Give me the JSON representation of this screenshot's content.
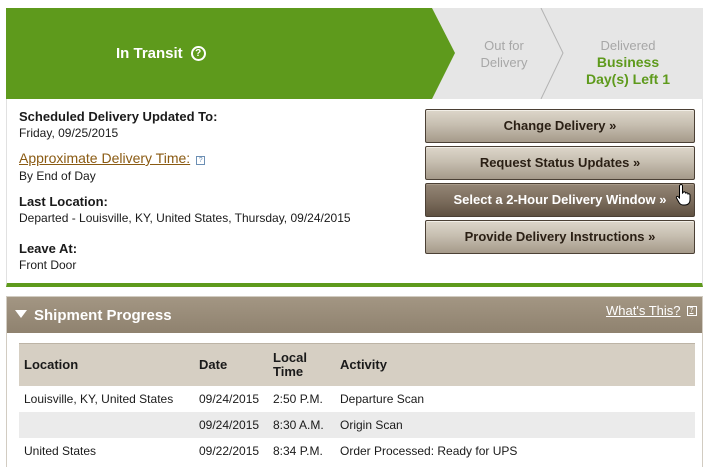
{
  "status": {
    "current": "In Transit",
    "help_icon": "question-circle-icon",
    "steps": [
      {
        "label": "Out for Delivery",
        "line1": "Out for",
        "line2": "Delivery"
      },
      {
        "label": "Delivered",
        "sub": "Business Day(s) Left 1",
        "sub1": "Business",
        "sub2": "Day(s) Left 1"
      }
    ],
    "colors": {
      "active": "#5e9a1c",
      "inactive": "#e6e6e6",
      "inactive_text": "#a7a7a7"
    }
  },
  "info": {
    "scheduled_label": "Scheduled Delivery Updated To:",
    "scheduled_value": "Friday, 09/25/2015",
    "approx_label": "Approximate Delivery Time:",
    "approx_value": "By End of Day",
    "last_location_label": "Last Location:",
    "last_location_value": "Departed - Louisville, KY, United States, Thursday, 09/24/2015",
    "leave_at_label": "Leave At:",
    "leave_at_value": "Front Door"
  },
  "actions": {
    "change_delivery": "Change Delivery »",
    "request_updates": "Request Status Updates »",
    "delivery_window": "Select a 2-Hour Delivery Window »",
    "delivery_instructions": "Provide Delivery Instructions »"
  },
  "progress": {
    "title": "Shipment Progress",
    "whats_this": "What's This?",
    "columns": {
      "location": "Location",
      "date": "Date",
      "time_line1": "Local",
      "time_line2": "Time",
      "activity": "Activity"
    },
    "rows": [
      {
        "location": "Louisville, KY, United States",
        "date": "09/24/2015",
        "time": "2:50 P.M.",
        "activity": "Departure Scan"
      },
      {
        "location": "",
        "date": "09/24/2015",
        "time": "8:30 A.M.",
        "activity": "Origin Scan"
      },
      {
        "location": "United States",
        "date": "09/22/2015",
        "time": "8:34 P.M.",
        "activity": "Order Processed: Ready for UPS"
      }
    ]
  }
}
